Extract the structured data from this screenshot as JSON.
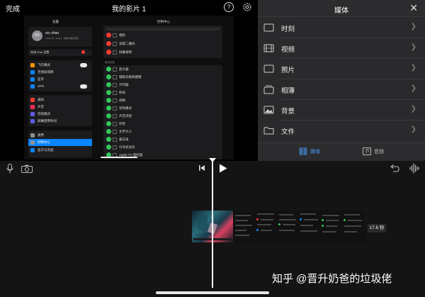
{
  "header": {
    "done_label": "完成",
    "project_title": "我的影片 1",
    "help_glyph": "?"
  },
  "preview": {
    "settings_heading": "设置",
    "control_heading": "控制中心",
    "profile": {
      "initials": "RZ",
      "name": "roc zhao",
      "subtitle": "Apple ID、iCloud、媒体与购买项目"
    },
    "finish_setup": "完成 iPad 设置",
    "group_a": [
      "飞行模式",
      "无线局域网",
      "蓝牙",
      "VPN"
    ],
    "group_b": [
      "通知",
      "声音",
      "勿扰模式",
      "屏幕使用时间"
    ],
    "group_c": [
      "通用",
      "控制中心",
      "显示与亮度"
    ],
    "included_top": [
      "相机",
      "读取二维码",
      "屏幕录制"
    ],
    "more_controls_label": "更多控制",
    "more_controls": [
      "放大器",
      "辅助功能快捷键",
      "计时器",
      "秒表",
      "闹钟",
      "深色模式",
      "声音识别",
      "听觉",
      "文字大小",
      "备忘录",
      "引导式访问",
      "Apple TV 遥控器"
    ]
  },
  "media_panel": {
    "title": "媒体",
    "items": [
      {
        "label": "时刻",
        "icon": "moments-icon"
      },
      {
        "label": "视频",
        "icon": "film-icon"
      },
      {
        "label": "照片",
        "icon": "photo-frame-icon"
      },
      {
        "label": "相簿",
        "icon": "album-icon"
      },
      {
        "label": "背景",
        "icon": "landscape-icon"
      },
      {
        "label": "文件",
        "icon": "folder-icon"
      }
    ],
    "tabs": [
      {
        "label": "媒体",
        "active": true
      },
      {
        "label": "音频",
        "active": false
      }
    ]
  },
  "timeline": {
    "clip_duration": "17.6 秒"
  },
  "watermark": "知乎 @晋升奶爸的垃圾佬",
  "colors": {
    "accent": "#0a84ff",
    "panel_bg": "#2a2a2c",
    "timeline_bg": "#141414",
    "active_tab": "#4a9eff"
  }
}
